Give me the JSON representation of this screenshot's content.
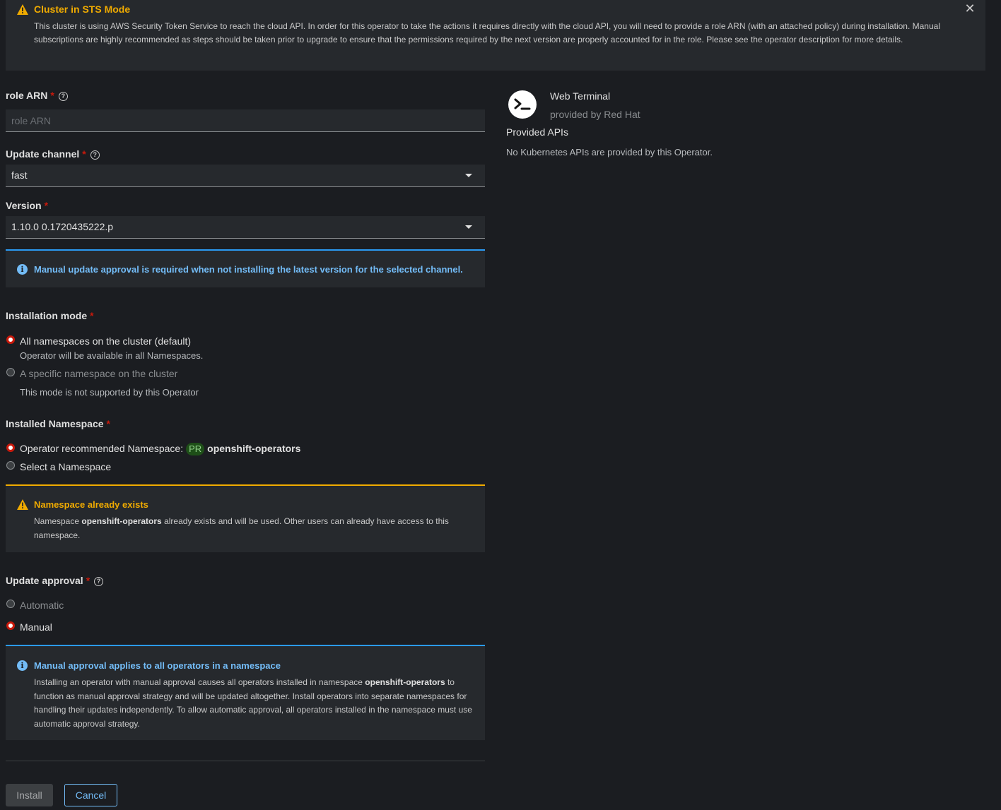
{
  "sts_banner": {
    "title": "Cluster in STS Mode",
    "body": "This cluster is using AWS Security Token Service to reach the cloud API. In order for this operator to take the actions it requires directly with the cloud API, you will need to provide a role ARN (with an attached policy) during installation. Manual subscriptions are highly recommended as steps should be taken prior to upgrade to ensure that the permissions required by the next version are properly accounted for in the role. Please see the operator description for more details."
  },
  "role_arn": {
    "label": "role ARN",
    "placeholder": "role ARN",
    "value": ""
  },
  "update_channel": {
    "label": "Update channel",
    "value": "fast"
  },
  "version": {
    "label": "Version",
    "value": "1.10.0 0.1720435222.p"
  },
  "manual_update_alert": {
    "title": "Manual update approval is required when not installing the latest version for the selected channel."
  },
  "installation_mode": {
    "label": "Installation mode",
    "options": [
      {
        "label": "All namespaces on the cluster (default)",
        "description": "Operator will be available in all Namespaces.",
        "selected": true,
        "disabled": false
      },
      {
        "label": "A specific namespace on the cluster",
        "description": "This mode is not supported by this Operator",
        "selected": false,
        "disabled": true
      }
    ]
  },
  "installed_namespace": {
    "label": "Installed Namespace",
    "recommended_prefix": "Operator recommended Namespace:",
    "badge": "PR",
    "namespace": "openshift-operators",
    "select_label": "Select a Namespace"
  },
  "namespace_exists_alert": {
    "title": "Namespace already exists",
    "body_prefix": "Namespace",
    "namespace": "openshift-operators",
    "body_suffix": "already exists and will be used. Other users can already have access to this namespace."
  },
  "update_approval": {
    "label": "Update approval",
    "options": [
      {
        "label": "Automatic",
        "selected": false
      },
      {
        "label": "Manual",
        "selected": true
      }
    ]
  },
  "manual_approval_alert": {
    "title": "Manual approval applies to all operators in a namespace",
    "body_prefix": "Installing an operator with manual approval causes all operators installed in namespace",
    "namespace": "openshift-operators",
    "body_suffix": "to function as manual approval strategy and will be updated altogether. Install operators into separate namespaces for handling their updates independently. To allow automatic approval, all operators installed in the namespace must use automatic approval strategy."
  },
  "buttons": {
    "install": "Install",
    "cancel": "Cancel"
  },
  "operator": {
    "name": "Web Terminal",
    "provider": "provided by Red Hat",
    "icon": "terminal-icon",
    "provided_apis_title": "Provided APIs",
    "provided_apis_empty": "No Kubernetes APIs are provided by this Operator."
  },
  "colors": {
    "warning": "#f0ab00",
    "info": "#73bcf7",
    "required": "#c9190b",
    "background": "#1b1d21",
    "panel": "#26292d"
  }
}
